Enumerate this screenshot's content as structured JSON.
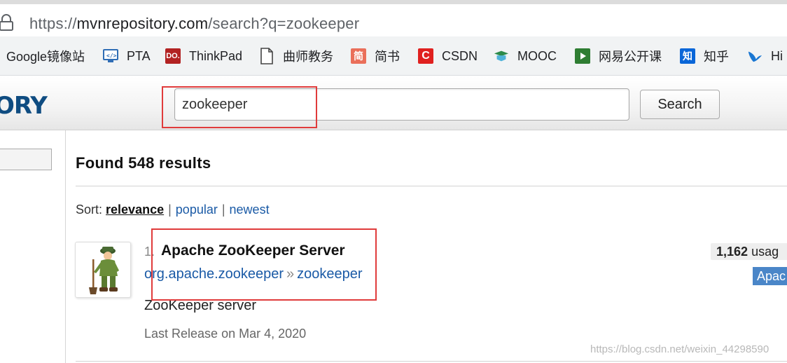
{
  "browser": {
    "url_prefix": "https://",
    "url_host": "mvnrepository.com",
    "url_path": "/search?q=zookeeper",
    "bookmarks": [
      {
        "label": "Google镜像站",
        "icon": "none",
        "color": ""
      },
      {
        "label": "PTA",
        "icon": "code-window-icon",
        "color": "#2f6db5"
      },
      {
        "label": "ThinkPad",
        "icon": "do-badge-icon",
        "color": "#b22222"
      },
      {
        "label": "曲师教务",
        "icon": "document-icon",
        "color": "#555555"
      },
      {
        "label": "简书",
        "icon": "jianshu-icon",
        "color": "#ea6f5a"
      },
      {
        "label": "CSDN",
        "icon": "csdn-icon",
        "color": "#e0201f"
      },
      {
        "label": "MOOC",
        "icon": "mooc-icon",
        "color": "#2c8a4a"
      },
      {
        "label": "网易公开课",
        "icon": "play-icon",
        "color": "#2e7d32"
      },
      {
        "label": "知乎",
        "icon": "zhihu-icon",
        "color": "#0a66d8"
      },
      {
        "label": "Hi",
        "icon": "bird-icon",
        "color": "#1976d2"
      }
    ]
  },
  "site": {
    "logo_text": "ORY",
    "search_value": "zookeeper",
    "search_button": "Search"
  },
  "results": {
    "heading": "Found 548 results",
    "sort_label": "Sort:",
    "sort_options": [
      "relevance",
      "popular",
      "newest"
    ],
    "sort_active": "relevance",
    "items": [
      {
        "index": "1.",
        "title": "Apache ZooKeeper Server",
        "group": "org.apache.zookeeper",
        "artifact": "zookeeper",
        "description": "ZooKeeper server",
        "last_release": "Last Release on Mar 4, 2020",
        "usages_count": "1,162",
        "usages_label": "usag",
        "license": "Apac"
      }
    ]
  },
  "watermark": "https://blog.csdn.net/weixin_44298590",
  "colors": {
    "link": "#1a5aa6",
    "highlight": "#e03b3b",
    "license_badge": "#4a86c8"
  }
}
